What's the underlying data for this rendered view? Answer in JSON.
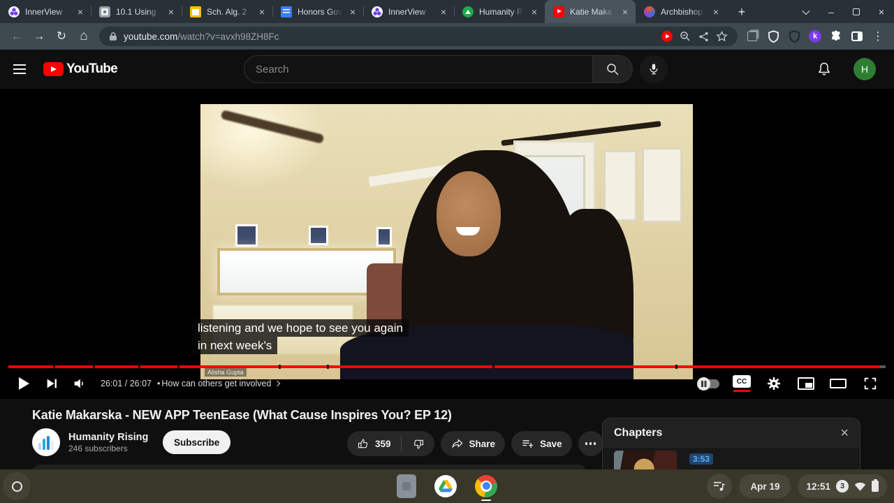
{
  "browser": {
    "tabs": [
      {
        "title": "InnerView"
      },
      {
        "title": "10.1 Using"
      },
      {
        "title": "Sch. Alg. 2"
      },
      {
        "title": "Honors Gov"
      },
      {
        "title": "InnerView"
      },
      {
        "title": "Humanity R"
      },
      {
        "title": "Katie Maka"
      },
      {
        "title": "Archbishop"
      }
    ],
    "active_tab_index": 6,
    "url": {
      "host": "youtube.com",
      "path": "/watch?v=avxh98ZH8Fc"
    },
    "extensions": {
      "kami_letter": "k"
    }
  },
  "yt_header": {
    "search_placeholder": "Search",
    "avatar_initial": "H"
  },
  "player": {
    "captions_line1": "listening and we hope to see you again",
    "captions_line2": "in next week's",
    "name_tag": "Alisha Gupta",
    "time_display": "26:01 / 26:07",
    "chapter_label": "How can others get involved",
    "cc_label": "CC",
    "progress_percent": 99.4,
    "segment_gaps_percent": [
      5.1,
      9.6,
      14.8,
      19.3,
      30.8,
      36.3,
      55.2,
      76.0
    ]
  },
  "video_info": {
    "title": "Katie Makarska - NEW APP TeenEase (What Cause Inspires You? EP 12)",
    "channel_name": "Humanity Rising",
    "subscribers": "246 subscribers",
    "subscribe_label": "Subscribe",
    "like_count": "359",
    "share_label": "Share",
    "save_label": "Save"
  },
  "chapters_panel": {
    "title": "Chapters",
    "visible_timestamp": "3:53"
  },
  "shelf": {
    "date": "Apr 19",
    "time": "12:51",
    "notification_count": "3"
  },
  "colors": {
    "youtube_red": "#ff0000",
    "progress_red": "#ff0000",
    "chapter_time_blue": "#5caeff",
    "avatar_green": "#2e7d32",
    "kami_purple": "#7c3aed",
    "shelf_olive": "#383729"
  }
}
